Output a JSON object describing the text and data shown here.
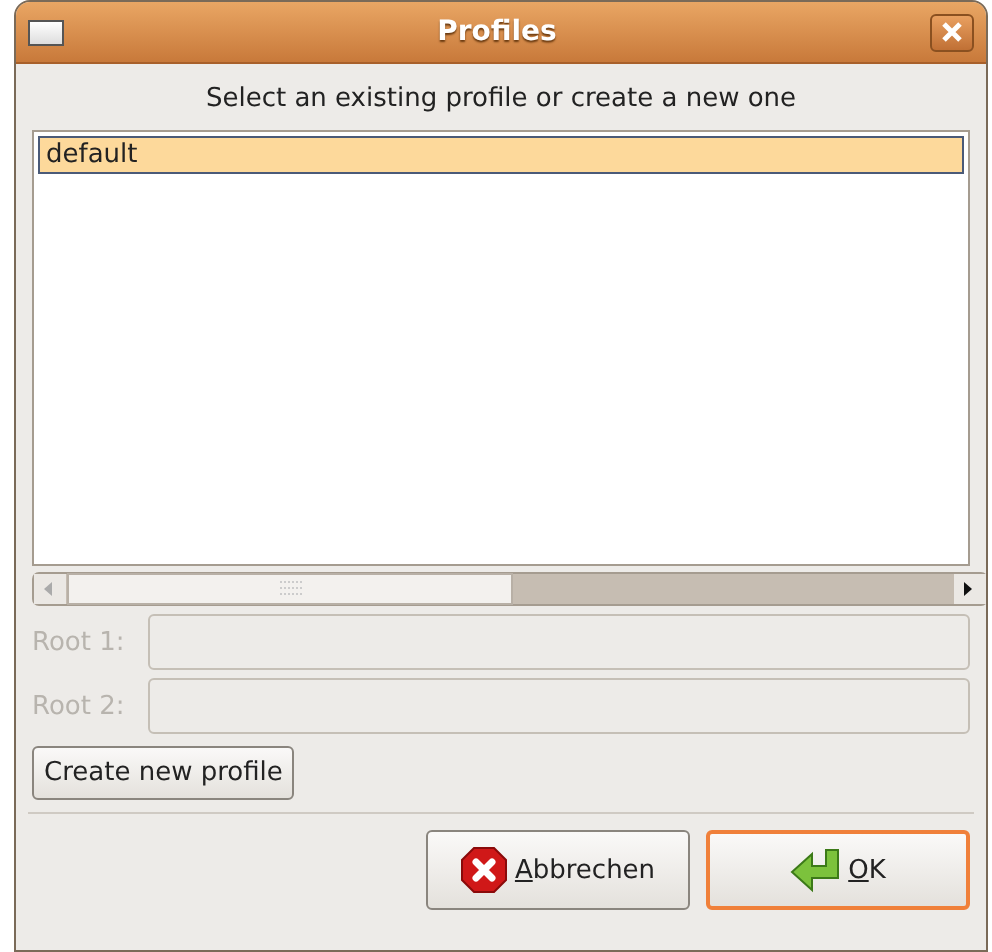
{
  "window": {
    "title": "Profiles"
  },
  "prompt": "Select an existing profile or create a new one",
  "profiles": [
    {
      "name": "default",
      "selected": true
    }
  ],
  "fields": [
    {
      "label": "Root 1:",
      "disabled": true
    },
    {
      "label": "Root 2:",
      "disabled": true
    }
  ],
  "create_button": "Create new profile",
  "buttons": [
    {
      "kind": "cancel",
      "mnemonic": "A",
      "rest": "bbrechen",
      "focused": false
    },
    {
      "kind": "ok",
      "mnemonic": "O",
      "rest": "K",
      "focused": true
    }
  ]
}
